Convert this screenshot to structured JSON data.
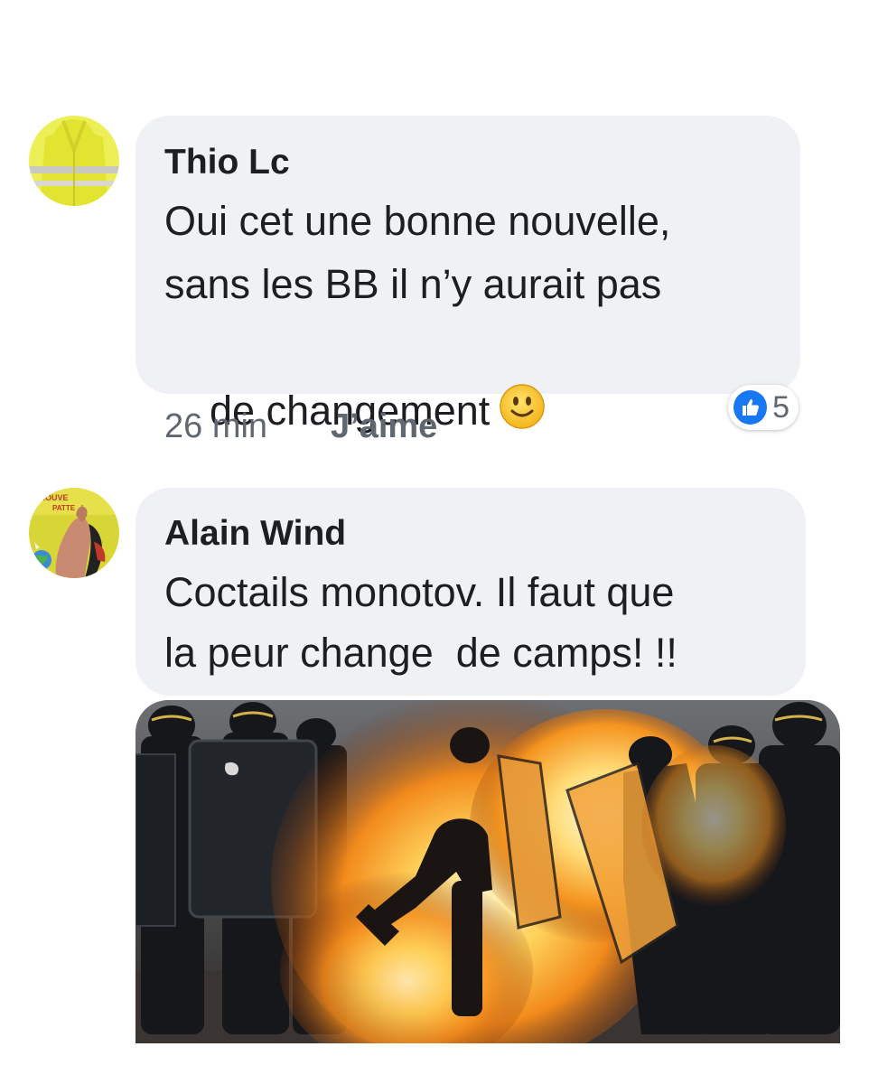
{
  "comments": [
    {
      "author": "Thio Lc",
      "lines": [
        "Oui cet une bonne nouvelle,",
        "sans les BB il n’y aurait pas",
        "de changement"
      ],
      "emoji": "slightly-smiling-face-icon",
      "time": "26 min",
      "like_label": "J’aime",
      "reaction_count": "5",
      "avatar": "yellow-vest-avatar"
    },
    {
      "author": "Alain Wind",
      "lines": [
        "Coctails monotov. Il faut que",
        "la peur change  de camps! !!"
      ],
      "avatar": "photo-avatar",
      "avatar_sign_text": [
        "TROUVE",
        "PATTE ..!"
      ],
      "attachment": "riot-police-fire-photo"
    }
  ],
  "colors": {
    "bubble": "#f0f1f4",
    "like_blue": "#1877f2",
    "meta_grey": "#606770"
  }
}
